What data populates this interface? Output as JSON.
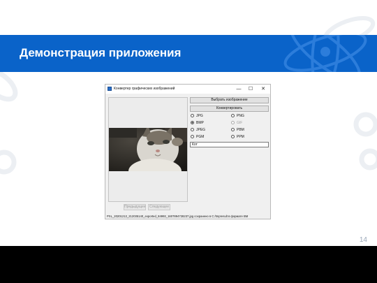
{
  "slide": {
    "title": "Демонстрация приложения",
    "page_number": "14",
    "accent_color": "#0a63c9"
  },
  "window": {
    "title": "Конвертер графических изображений",
    "controls": {
      "minimize": "—",
      "maximize": "☐",
      "close": "✕"
    },
    "select_image_label": "Выбрать изображение",
    "convert_label": "Конвертировать",
    "formats_left": [
      {
        "label": "JPG",
        "checked": false,
        "enabled": true
      },
      {
        "label": "BMP",
        "checked": true,
        "enabled": true
      },
      {
        "label": "JPEG",
        "checked": false,
        "enabled": true
      },
      {
        "label": "PGM",
        "checked": false,
        "enabled": true
      }
    ],
    "formats_right": [
      {
        "label": "PNG",
        "checked": false,
        "enabled": true
      },
      {
        "label": "GIF",
        "checked": false,
        "enabled": false
      },
      {
        "label": "PBM",
        "checked": false,
        "enabled": true
      },
      {
        "label": "PPM",
        "checked": false,
        "enabled": true
      }
    ],
    "name_field_value": "Кот",
    "preview_button_label": "Предыдущее",
    "save_button_label": "Следующее",
    "status_text": "PXL_20201213_212035140_exported_84993_1607894728237.jpg сохранено в C:/tmpresult в формате BM"
  }
}
